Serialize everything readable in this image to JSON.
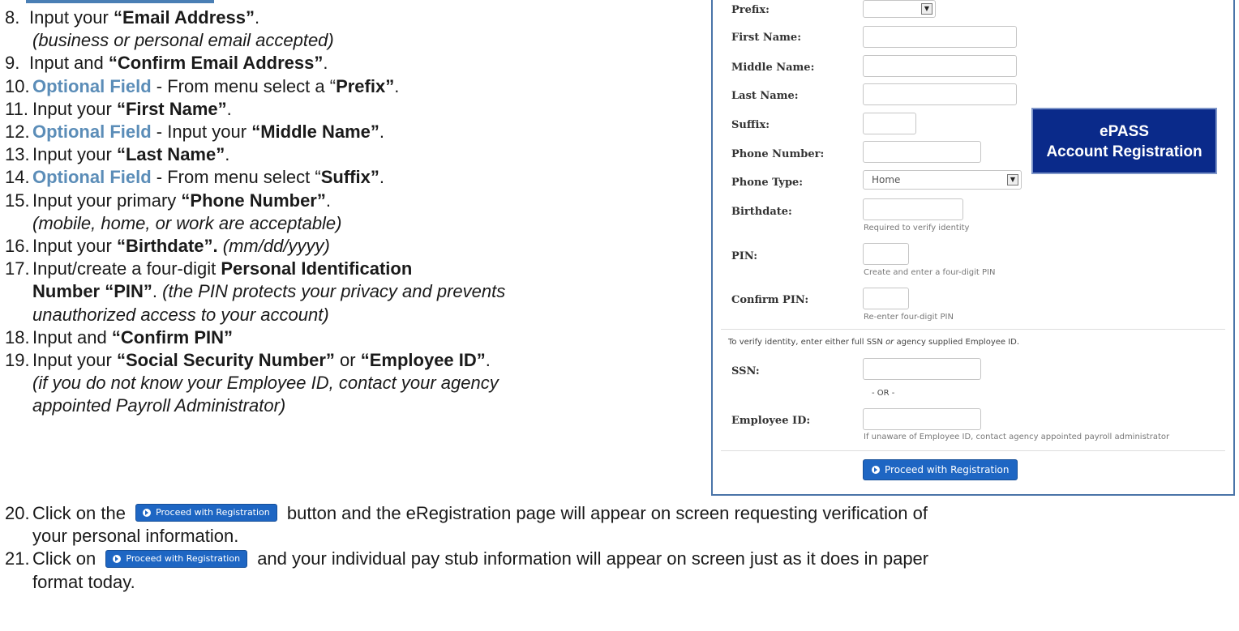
{
  "steps": [
    {
      "num": "8.",
      "a": "Input your ",
      "b": "“Email Address”",
      "c": ".",
      "sub": "(business or personal email accepted)"
    },
    {
      "num": "9.",
      "a": "Input and ",
      "b": "“Confirm Email Address”",
      "c": "."
    },
    {
      "num": "10.",
      "opt": "Optional Field",
      "a": " - From menu select a “",
      "b": "Prefix”",
      "c": "."
    },
    {
      "num": "11.",
      "a": "Input your ",
      "b": "“First Name”",
      "c": "."
    },
    {
      "num": "12.",
      "opt": "Optional Field",
      "a": " - Input your ",
      "b": "“Middle Name”",
      "c": "."
    },
    {
      "num": "13.",
      "a": "Input your ",
      "b": "“Last Name”",
      "c": "."
    },
    {
      "num": "14.",
      "opt": "Optional Field",
      "a": " - From menu select “",
      "b": "Suffix”",
      "c": "."
    },
    {
      "num": "15.",
      "a": "Input your primary ",
      "b": "“Phone Number”",
      "c": ".",
      "sub": "(mobile, home, or work are acceptable)"
    },
    {
      "num": "16.",
      "a": "Input your ",
      "b": "“Birthdate”.",
      "c": " ",
      "ital": "(mm/dd/yyyy)"
    },
    {
      "num": "17.",
      "a": "Input/create a four-digit ",
      "b": "Personal Identification",
      "line2b": "Number “PIN”",
      "line2a": ". ",
      "line2i": "(the PIN protects your privacy and prevents",
      "line3i": "unauthorized access to your account)"
    },
    {
      "num": "18.",
      "a": "Input and ",
      "b": "“Confirm PIN”",
      "c": ""
    },
    {
      "num": "19.",
      "a": "Input your ",
      "b": "“Social Security Number”",
      "c": " or ",
      "b2": "“Employee ID”",
      "c2": ".",
      "sub1": "(if you do not know your Employee ID, contact your agency",
      "sub2": "appointed Payroll Administrator)"
    }
  ],
  "form": {
    "labels": {
      "prefix": "Prefix:",
      "first": "First Name:",
      "middle": "Middle Name:",
      "last": "Last Name:",
      "suffix": "Suffix:",
      "phone": "Phone Number:",
      "phone_type": "Phone Type:",
      "birthdate": "Birthdate:",
      "pin": "PIN:",
      "confirm_pin": "Confirm PIN:",
      "ssn": "SSN:",
      "employee_id": "Employee ID:"
    },
    "phone_type_value": "Home",
    "help": {
      "birthdate": "Required to verify identity",
      "pin": "Create and enter a four-digit PIN",
      "confirm_pin": "Re-enter four-digit PIN",
      "employee_id": "If unaware of Employee ID, contact agency appointed payroll administrator"
    },
    "verify_note_a": "To verify identity, enter either full SSN ",
    "verify_note_or": "or",
    "verify_note_b": " agency supplied Employee ID.",
    "or_divider": "- OR -",
    "proceed_label": "Proceed with Registration"
  },
  "epass": {
    "line1": "ePASS",
    "line2": "Account Registration"
  },
  "bottom": {
    "s20_num": "20.",
    "s20_a": "Click on the",
    "s20_b": "button and the eRegistration page will appear on screen requesting verification of",
    "s20_c": "your personal information.",
    "s21_num": "21.",
    "s21_a": "Click on",
    "s21_b": "and your individual pay stub information will appear on screen just as it does in paper",
    "s21_c": "format  today.",
    "btn_label": "Proceed with Registration"
  }
}
